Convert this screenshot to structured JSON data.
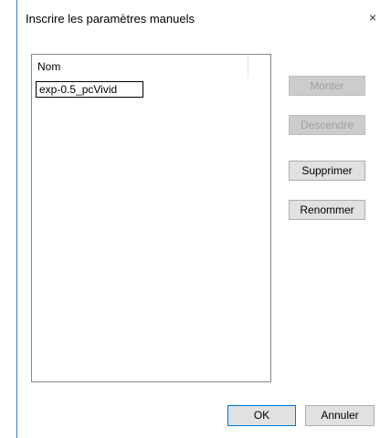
{
  "window": {
    "title": "Inscrire les paramètres manuels",
    "close_glyph": "×"
  },
  "list": {
    "column_header": "Nom",
    "edit_value": "exp-0.5_pcVivid"
  },
  "buttons": {
    "up": "Monter",
    "down": "Descendre",
    "delete": "Supprimer",
    "rename": "Renommer",
    "ok": "OK",
    "cancel": "Annuler"
  },
  "colors": {
    "accent": "#0078d7",
    "button_face": "#e1e1e1",
    "disabled_text": "#a0a0a0"
  }
}
